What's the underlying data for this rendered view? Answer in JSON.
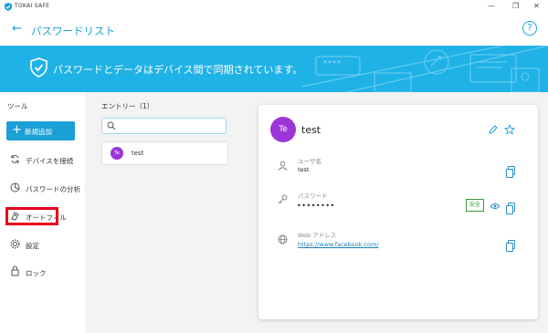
{
  "window": {
    "title": "TOKAI SAFE",
    "minimize": "—",
    "maximize": "❐",
    "close": "✕"
  },
  "header": {
    "back": "←",
    "title": "パスワードリスト",
    "help": "?"
  },
  "banner": {
    "text": "パスワードとデータはデバイス間で同期されています。",
    "field_mask": "****"
  },
  "sidebar": {
    "section_label": "ツール",
    "add_button": "新規追加",
    "items": [
      {
        "label": "デバイスを接続",
        "icon": "sync-icon"
      },
      {
        "label": "パスワードの分析",
        "icon": "analysis-icon"
      },
      {
        "label": "オートフィル",
        "icon": "autofill-icon"
      },
      {
        "label": "設定",
        "icon": "gear-icon"
      },
      {
        "label": "ロック",
        "icon": "lock-icon"
      }
    ]
  },
  "entries": {
    "heading": "エントリー（1）",
    "search_placeholder": "",
    "list": [
      {
        "initials": "Te",
        "name": "test"
      }
    ]
  },
  "detail": {
    "initials": "Te",
    "title": "test",
    "fields": {
      "username": {
        "label": "ユーザ名",
        "value": "test"
      },
      "password": {
        "label": "パスワード",
        "value": "••••••••",
        "badge": "安全"
      },
      "url": {
        "label": "Web アドレス",
        "value": "https://www.facebook.com/"
      }
    }
  },
  "colors": {
    "accent": "#1aa0d6",
    "banner": "#1fb2e6",
    "avatar": "#9b35d6",
    "highlight": "#e8001f",
    "safe_badge": "#3a9a3a"
  }
}
